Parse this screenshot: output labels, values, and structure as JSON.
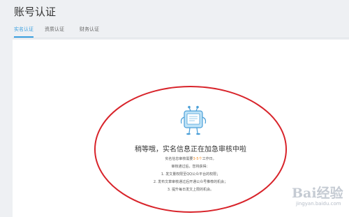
{
  "header": {
    "title": "账号认证"
  },
  "tabs": [
    {
      "label": "实名认证",
      "active": true
    },
    {
      "label": "资质认证",
      "active": false
    },
    {
      "label": "财务认证",
      "active": false
    }
  ],
  "status": {
    "heading": "稍等哦，实名信息正在加急审核中啦",
    "review_prefix": "实名信息审核需要",
    "review_highlight": "3-5个",
    "review_suffix": "工作日。",
    "after_pass": "审核通过后，您将获得：",
    "benefits": [
      "1. 发文量权限至QQ公众平台的权限；",
      "2. 发布文章审核通过后开通公众号推荐的机会；",
      "3. 提升每日发文上限的机会。"
    ]
  },
  "watermark": {
    "text": "Bai经验",
    "sub": "jingyan.baidu.com"
  },
  "colors": {
    "accent": "#3ba0e0",
    "highlight": "#f08a24",
    "annotation": "#d8232a"
  }
}
